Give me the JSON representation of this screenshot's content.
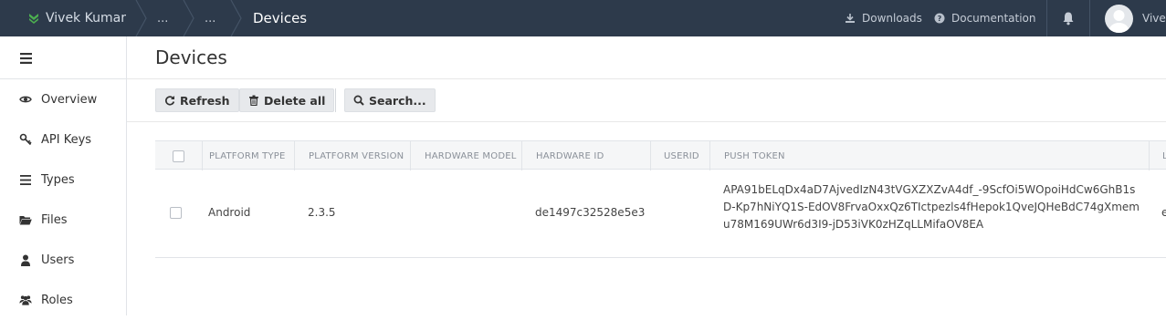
{
  "topbar": {
    "app_name": "Vivek Kumar",
    "breadcrumbs": [
      "...",
      "...",
      "Devices"
    ],
    "downloads_label": "Downloads",
    "documentation_label": "Documentation",
    "user_name": "Vivek"
  },
  "sidebar": {
    "items": [
      {
        "label": "Overview",
        "icon": "eye-icon"
      },
      {
        "label": "API Keys",
        "icon": "key-icon"
      },
      {
        "label": "Types",
        "icon": "list-icon"
      },
      {
        "label": "Files",
        "icon": "folder-icon"
      },
      {
        "label": "Users",
        "icon": "user-icon"
      },
      {
        "label": "Roles",
        "icon": "users-icon"
      }
    ]
  },
  "page": {
    "title": "Devices",
    "toolbar": {
      "refresh_label": "Refresh",
      "delete_all_label": "Delete all",
      "search_label": "Search..."
    }
  },
  "table": {
    "columns": [
      "PLATFORM TYPE",
      "PLATFORM VERSION",
      "HARDWARE MODEL",
      "HARDWARE ID",
      "USERID",
      "PUSH TOKEN",
      "L"
    ],
    "rows": [
      {
        "platform_type": "Android",
        "platform_version": "2.3.5",
        "hardware_model": "",
        "hardware_id": "de1497c32528e5e3",
        "userid": "",
        "push_token": "APA91bELqDx4aD7AjvedIzN43tVGXZXZvA4df_-9ScfOi5WOpoiHdCw6GhB1sD-Kp7hNiYQ1S-EdOV8FrvaOxxQz6TIctpezls4fHepok1QveJQHeBdC74gXmemu78M169UWr6d3I9-jD53iVK0zHZqLLMifaOV8EA",
        "last": "e"
      }
    ]
  },
  "colors": {
    "topbar_bg": "#2d3a4b",
    "brand_accent": "#4caf50",
    "button_bg": "#e7e9ec"
  }
}
